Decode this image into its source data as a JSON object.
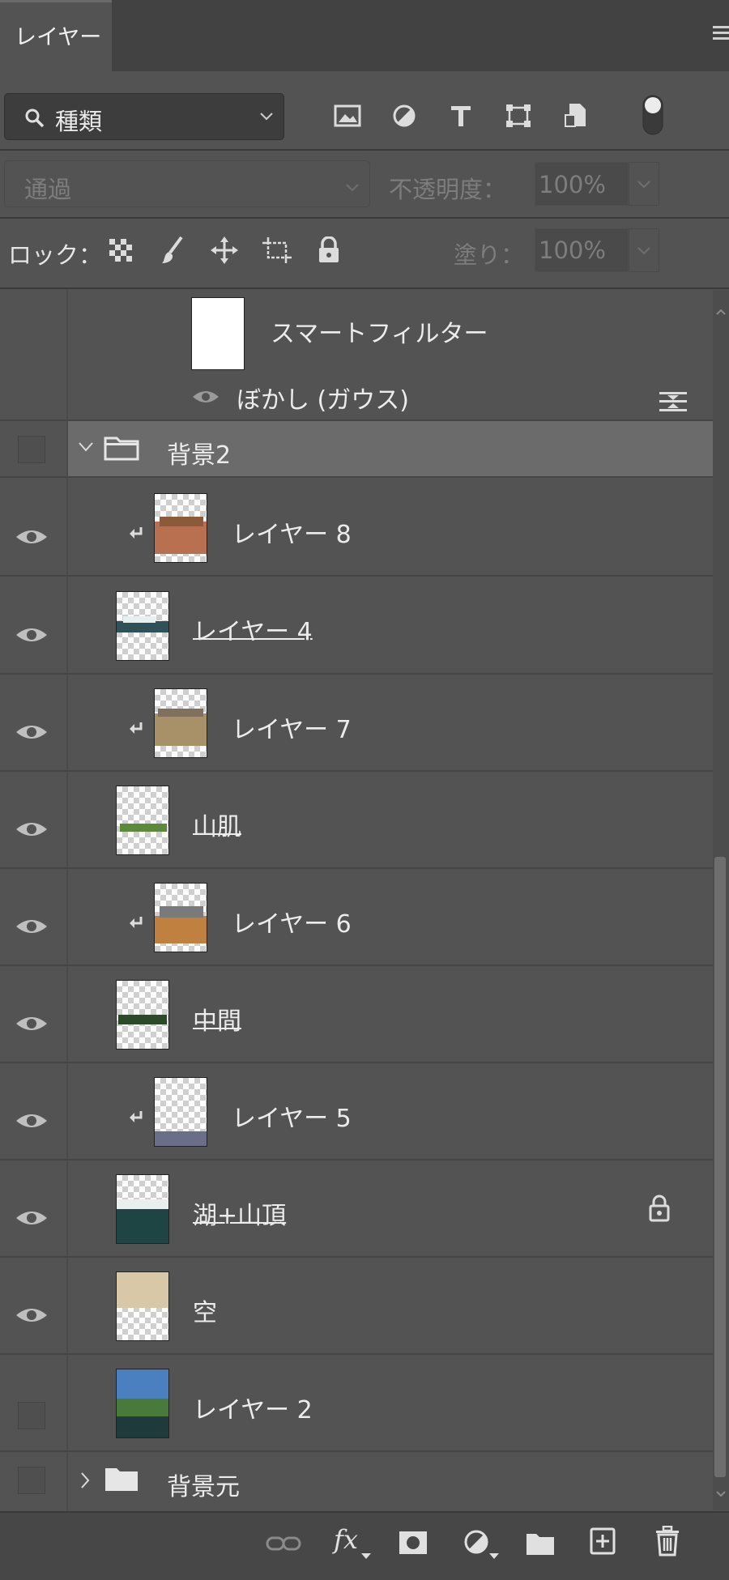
{
  "panel": {
    "tab_label": "レイヤー"
  },
  "filter": {
    "kind_label": "種類"
  },
  "blend": {
    "mode": "通過",
    "opacity_label": "不透明度：",
    "opacity_value": "100%"
  },
  "lock": {
    "label": "ロック：",
    "fill_label": "塗り：",
    "fill_value": "100%"
  },
  "smart_filter": {
    "label": "スマートフィルター",
    "effect": "ぼかし (ガウス)"
  },
  "layers": [
    {
      "name": "背景2",
      "kind": "group",
      "expanded": true,
      "visible": false
    },
    {
      "name": "レイヤー 8",
      "clipped": true,
      "visible": true,
      "thumb_color": "#b87050"
    },
    {
      "name": "レイヤー 4",
      "clipped": false,
      "visible": true,
      "thumb_color": "#30505a"
    },
    {
      "name": "レイヤー 7",
      "clipped": true,
      "visible": true,
      "thumb_color": "#a89068"
    },
    {
      "name": "山肌",
      "clipped": false,
      "visible": true,
      "thumb_color": "#5a8a3a"
    },
    {
      "name": "レイヤー 6",
      "clipped": true,
      "visible": true,
      "thumb_color": "#c08040"
    },
    {
      "name": "中間",
      "clipped": false,
      "visible": true,
      "thumb_color": "#2a4a2a"
    },
    {
      "name": "レイヤー 5",
      "clipped": true,
      "visible": true,
      "thumb_color": "#6a6e88"
    },
    {
      "name": "湖+山頂",
      "clipped": false,
      "visible": true,
      "locked": true,
      "thumb_color": "#1e4444"
    },
    {
      "name": "空",
      "clipped": false,
      "visible": true,
      "thumb_color": "#d8c8a8"
    },
    {
      "name": "レイヤー 2",
      "clipped": false,
      "visible": false,
      "thumb_color": "#4a80c0"
    },
    {
      "name": "背景元",
      "kind": "group",
      "expanded": false,
      "visible": false
    }
  ],
  "footer": {
    "fx_label": "fx"
  }
}
